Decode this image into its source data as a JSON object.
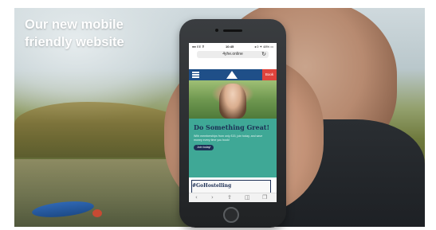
{
  "headline": {
    "line1": "Our new mobile",
    "line2": "friendly website"
  },
  "phone": {
    "status": {
      "carrier": "●● EE ⊽",
      "time": "10:45",
      "battery": "◂ 0 ✦ 48% ▭"
    },
    "url": "4yhe.online",
    "reload_icon": "↻",
    "menu_icon": "hamburger-icon",
    "logo_icon": "mountain-logo-icon",
    "book_label": "Book",
    "hero": {
      "heading": "Do Something Great!",
      "body": "With memberships from only £15, join today, and save money every time you book!",
      "cta": "Join today!"
    },
    "tag": "#GoHostelling",
    "toolbar": {
      "back": "‹",
      "forward": "›",
      "share": "⇪",
      "books": "◫",
      "tabs": "❐"
    }
  },
  "colors": {
    "nav": "#1f4f88",
    "teal": "#3fa896",
    "book": "#e0433c",
    "heading": "#1c2f55"
  }
}
